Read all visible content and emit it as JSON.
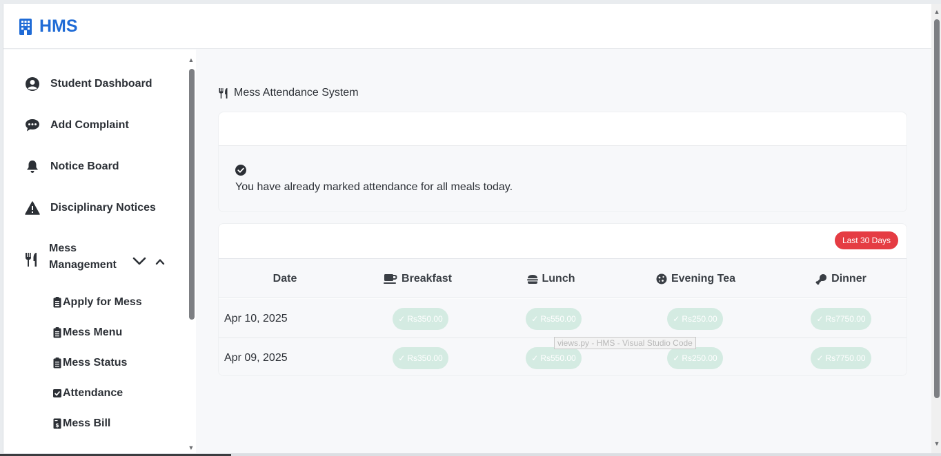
{
  "brand": {
    "name": "HMS"
  },
  "sidebar": {
    "items": [
      {
        "label": "Student Dashboard",
        "icon": "user-circle-icon"
      },
      {
        "label": "Add Complaint",
        "icon": "comment-dots-icon"
      },
      {
        "label": "Notice Board",
        "icon": "bell-icon"
      },
      {
        "label": "Disciplinary Notices",
        "icon": "warning-triangle-icon"
      }
    ],
    "mess": {
      "label": "Mess Management",
      "icon": "utensils-icon",
      "sub_items": [
        {
          "label": "Apply for Mess",
          "icon": "clipboard-icon"
        },
        {
          "label": "Mess Menu",
          "icon": "clipboard-icon"
        },
        {
          "label": "Mess Status",
          "icon": "clipboard-icon"
        },
        {
          "label": "Attendance",
          "icon": "check-square-icon"
        },
        {
          "label": "Mess Bill",
          "icon": "bill-icon"
        }
      ]
    }
  },
  "main": {
    "title": "Mess Attendance System",
    "message": "You have already marked attendance for all meals today.",
    "badge": "Last 30 Days",
    "columns": [
      {
        "label": "Date"
      },
      {
        "label": "Breakfast",
        "icon": "coffee-icon"
      },
      {
        "label": "Lunch",
        "icon": "hamburger-icon"
      },
      {
        "label": "Evening Tea",
        "icon": "cookie-icon"
      },
      {
        "label": "Dinner",
        "icon": "drumstick-icon"
      }
    ],
    "rows": [
      {
        "date": "Apr 10, 2025",
        "breakfast": "Rs350.00",
        "lunch": "Rs550.00",
        "tea": "Rs250.00",
        "dinner": "Rs7750.00"
      },
      {
        "date": "Apr 09, 2025",
        "breakfast": "Rs350.00",
        "lunch": "Rs550.00",
        "tea": "Rs250.00",
        "dinner": "Rs7750.00"
      }
    ]
  },
  "tooltip": "views.py - HMS - Visual Studio Code",
  "colors": {
    "brand": "#1f6bd6",
    "badge": "#e53c43",
    "pill": "#d4ebe2"
  }
}
